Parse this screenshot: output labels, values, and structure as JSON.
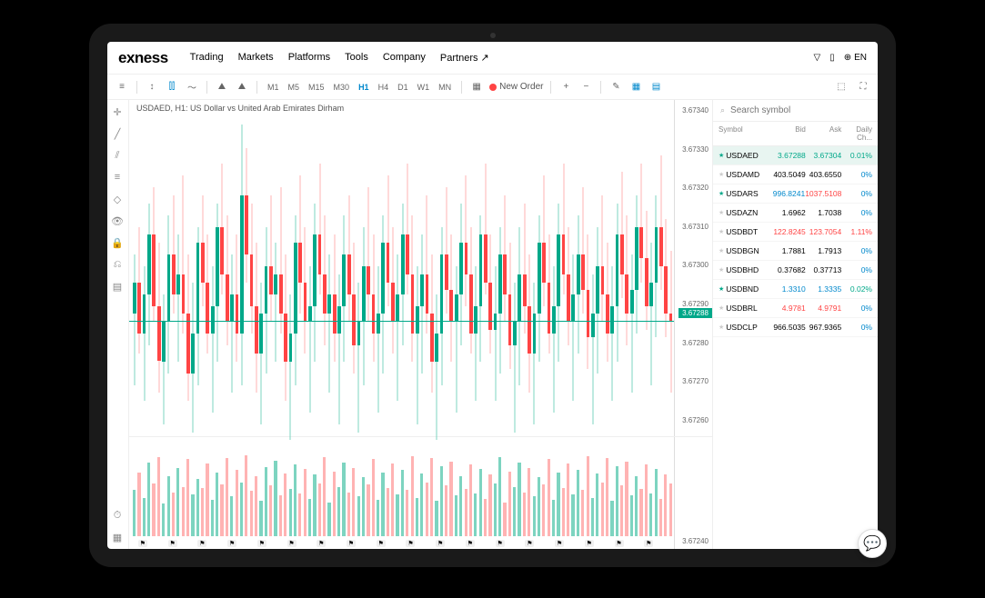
{
  "brand": "exness",
  "nav": [
    "Trading",
    "Markets",
    "Platforms",
    "Tools",
    "Company",
    "Partners ↗"
  ],
  "lang": "EN",
  "toolbar": {
    "timeframes": [
      "M1",
      "M5",
      "M15",
      "M30",
      "H1",
      "H4",
      "D1",
      "W1",
      "MN"
    ],
    "active_tf": "H1",
    "new_order": "New Order"
  },
  "chart": {
    "title": "USDAED, H1: US Dollar vs United Arab Emirates Dirham",
    "y_ticks": [
      "3.67340",
      "3.67330",
      "3.67320",
      "3.67310",
      "3.67300",
      "3.67290",
      "3.67280",
      "3.67270",
      "3.67260"
    ],
    "price_label": "3.67288",
    "sub_y": "3.67240"
  },
  "watchlist": {
    "search_ph": "Search symbol",
    "headers": [
      "Symbol",
      "Bid",
      "Ask",
      "Daily Ch..."
    ],
    "rows": [
      {
        "sym": "USDAED",
        "bid": "3.67288",
        "ask": "3.67304",
        "ch": "0.01%",
        "star": true,
        "bidc": "up",
        "askc": "up",
        "chc": "up",
        "active": true
      },
      {
        "sym": "USDAMD",
        "bid": "403.5049",
        "ask": "403.6550",
        "ch": "0%",
        "star": false,
        "bidc": "",
        "askc": "",
        "chc": "flat"
      },
      {
        "sym": "USDARS",
        "bid": "996.8241",
        "ask": "1037.5108",
        "ch": "0%",
        "star": true,
        "bidc": "blue",
        "askc": "down",
        "chc": "flat"
      },
      {
        "sym": "USDAZN",
        "bid": "1.6962",
        "ask": "1.7038",
        "ch": "0%",
        "star": false,
        "bidc": "",
        "askc": "",
        "chc": "flat"
      },
      {
        "sym": "USDBDT",
        "bid": "122.8245",
        "ask": "123.7054",
        "ch": "1.11%",
        "star": false,
        "bidc": "down",
        "askc": "down",
        "chc": "down"
      },
      {
        "sym": "USDBGN",
        "bid": "1.7881",
        "ask": "1.7913",
        "ch": "0%",
        "star": false,
        "bidc": "",
        "askc": "",
        "chc": "flat"
      },
      {
        "sym": "USDBHD",
        "bid": "0.37682",
        "ask": "0.37713",
        "ch": "0%",
        "star": false,
        "bidc": "",
        "askc": "",
        "chc": "flat"
      },
      {
        "sym": "USDBND",
        "bid": "1.3310",
        "ask": "1.3335",
        "ch": "0.02%",
        "star": true,
        "bidc": "blue",
        "askc": "blue",
        "chc": "up"
      },
      {
        "sym": "USDBRL",
        "bid": "4.9781",
        "ask": "4.9791",
        "ch": "0%",
        "star": false,
        "bidc": "down",
        "askc": "down",
        "chc": "flat"
      },
      {
        "sym": "USDCLP",
        "bid": "966.5035",
        "ask": "967.9365",
        "ch": "0%",
        "star": false,
        "bidc": "",
        "askc": "",
        "chc": "flat"
      }
    ]
  },
  "chart_data": {
    "type": "candlestick",
    "title": "USDAED H1",
    "ylim": [
      3.6726,
      3.6734
    ],
    "candles": [
      {
        "o": 3.6729,
        "h": 3.67305,
        "l": 3.67272,
        "c": 3.67298,
        "v": 42
      },
      {
        "o": 3.67298,
        "h": 3.67312,
        "l": 3.6728,
        "c": 3.67285,
        "v": 58
      },
      {
        "o": 3.67285,
        "h": 3.67302,
        "l": 3.67268,
        "c": 3.67295,
        "v": 35
      },
      {
        "o": 3.67295,
        "h": 3.67318,
        "l": 3.67282,
        "c": 3.6731,
        "v": 67
      },
      {
        "o": 3.6731,
        "h": 3.67322,
        "l": 3.67288,
        "c": 3.67292,
        "v": 48
      },
      {
        "o": 3.67292,
        "h": 3.67308,
        "l": 3.6727,
        "c": 3.67278,
        "v": 72
      },
      {
        "o": 3.67278,
        "h": 3.67295,
        "l": 3.67262,
        "c": 3.67288,
        "v": 30
      },
      {
        "o": 3.67288,
        "h": 3.67315,
        "l": 3.67275,
        "c": 3.67305,
        "v": 55
      },
      {
        "o": 3.67305,
        "h": 3.6732,
        "l": 3.6729,
        "c": 3.67295,
        "v": 40
      },
      {
        "o": 3.67295,
        "h": 3.6731,
        "l": 3.67278,
        "c": 3.673,
        "v": 62
      },
      {
        "o": 3.673,
        "h": 3.67325,
        "l": 3.67285,
        "c": 3.6729,
        "v": 45
      },
      {
        "o": 3.6729,
        "h": 3.67305,
        "l": 3.67268,
        "c": 3.67275,
        "v": 70
      },
      {
        "o": 3.67275,
        "h": 3.67298,
        "l": 3.6726,
        "c": 3.67285,
        "v": 38
      },
      {
        "o": 3.67285,
        "h": 3.67312,
        "l": 3.67272,
        "c": 3.67308,
        "v": 52
      },
      {
        "o": 3.67308,
        "h": 3.6732,
        "l": 3.67292,
        "c": 3.67298,
        "v": 44
      },
      {
        "o": 3.67298,
        "h": 3.6731,
        "l": 3.6728,
        "c": 3.67285,
        "v": 66
      },
      {
        "o": 3.67285,
        "h": 3.67302,
        "l": 3.67265,
        "c": 3.67292,
        "v": 33
      },
      {
        "o": 3.67292,
        "h": 3.67318,
        "l": 3.67278,
        "c": 3.67312,
        "v": 58
      },
      {
        "o": 3.67312,
        "h": 3.67328,
        "l": 3.67295,
        "c": 3.673,
        "v": 47
      },
      {
        "o": 3.673,
        "h": 3.67315,
        "l": 3.67282,
        "c": 3.67288,
        "v": 71
      },
      {
        "o": 3.67288,
        "h": 3.67305,
        "l": 3.6727,
        "c": 3.67295,
        "v": 36
      },
      {
        "o": 3.67295,
        "h": 3.6731,
        "l": 3.67278,
        "c": 3.67285,
        "v": 60
      },
      {
        "o": 3.67285,
        "h": 3.67338,
        "l": 3.67272,
        "c": 3.6732,
        "v": 49
      },
      {
        "o": 3.6732,
        "h": 3.67332,
        "l": 3.67298,
        "c": 3.67305,
        "v": 74
      },
      {
        "o": 3.67305,
        "h": 3.67318,
        "l": 3.67285,
        "c": 3.67292,
        "v": 41
      },
      {
        "o": 3.67292,
        "h": 3.67308,
        "l": 3.6727,
        "c": 3.6728,
        "v": 55
      },
      {
        "o": 3.6728,
        "h": 3.67298,
        "l": 3.67262,
        "c": 3.6729,
        "v": 32
      },
      {
        "o": 3.6729,
        "h": 3.67312,
        "l": 3.67275,
        "c": 3.67302,
        "v": 63
      },
      {
        "o": 3.67302,
        "h": 3.6732,
        "l": 3.67288,
        "c": 3.67295,
        "v": 46
      },
      {
        "o": 3.67295,
        "h": 3.67308,
        "l": 3.67278,
        "c": 3.673,
        "v": 69
      },
      {
        "o": 3.673,
        "h": 3.67322,
        "l": 3.67285,
        "c": 3.6729,
        "v": 37
      },
      {
        "o": 3.6729,
        "h": 3.67305,
        "l": 3.67268,
        "c": 3.67278,
        "v": 57
      },
      {
        "o": 3.67278,
        "h": 3.67295,
        "l": 3.67258,
        "c": 3.67285,
        "v": 43
      },
      {
        "o": 3.67285,
        "h": 3.67315,
        "l": 3.67272,
        "c": 3.67308,
        "v": 65
      },
      {
        "o": 3.67308,
        "h": 3.67325,
        "l": 3.6729,
        "c": 3.67298,
        "v": 39
      },
      {
        "o": 3.67298,
        "h": 3.67312,
        "l": 3.6728,
        "c": 3.67288,
        "v": 61
      },
      {
        "o": 3.67288,
        "h": 3.67302,
        "l": 3.67265,
        "c": 3.67292,
        "v": 34
      },
      {
        "o": 3.67292,
        "h": 3.67318,
        "l": 3.67278,
        "c": 3.6731,
        "v": 56
      },
      {
        "o": 3.6731,
        "h": 3.67328,
        "l": 3.67295,
        "c": 3.673,
        "v": 48
      },
      {
        "o": 3.673,
        "h": 3.67315,
        "l": 3.67282,
        "c": 3.6729,
        "v": 72
      },
      {
        "o": 3.6729,
        "h": 3.67305,
        "l": 3.6727,
        "c": 3.67295,
        "v": 31
      },
      {
        "o": 3.67295,
        "h": 3.6731,
        "l": 3.67278,
        "c": 3.67285,
        "v": 59
      },
      {
        "o": 3.67285,
        "h": 3.673,
        "l": 3.67262,
        "c": 3.67292,
        "v": 45
      },
      {
        "o": 3.67292,
        "h": 3.67315,
        "l": 3.67278,
        "c": 3.67305,
        "v": 67
      },
      {
        "o": 3.67305,
        "h": 3.6732,
        "l": 3.67288,
        "c": 3.67295,
        "v": 40
      },
      {
        "o": 3.67295,
        "h": 3.67308,
        "l": 3.67275,
        "c": 3.67282,
        "v": 62
      },
      {
        "o": 3.67282,
        "h": 3.67298,
        "l": 3.6726,
        "c": 3.67288,
        "v": 36
      },
      {
        "o": 3.67288,
        "h": 3.67312,
        "l": 3.67272,
        "c": 3.67302,
        "v": 54
      },
      {
        "o": 3.67302,
        "h": 3.67322,
        "l": 3.67288,
        "c": 3.67295,
        "v": 47
      },
      {
        "o": 3.67295,
        "h": 3.6731,
        "l": 3.67278,
        "c": 3.67285,
        "v": 70
      },
      {
        "o": 3.67285,
        "h": 3.67302,
        "l": 3.67265,
        "c": 3.6729,
        "v": 33
      },
      {
        "o": 3.6729,
        "h": 3.67315,
        "l": 3.67275,
        "c": 3.67308,
        "v": 58
      },
      {
        "o": 3.67308,
        "h": 3.67325,
        "l": 3.67292,
        "c": 3.67298,
        "v": 44
      },
      {
        "o": 3.67298,
        "h": 3.67312,
        "l": 3.6728,
        "c": 3.67288,
        "v": 66
      },
      {
        "o": 3.67288,
        "h": 3.67305,
        "l": 3.67268,
        "c": 3.67295,
        "v": 38
      },
      {
        "o": 3.67295,
        "h": 3.67318,
        "l": 3.67282,
        "c": 3.6731,
        "v": 60
      },
      {
        "o": 3.6731,
        "h": 3.67328,
        "l": 3.67295,
        "c": 3.673,
        "v": 42
      },
      {
        "o": 3.673,
        "h": 3.67315,
        "l": 3.67278,
        "c": 3.67285,
        "v": 73
      },
      {
        "o": 3.67285,
        "h": 3.67302,
        "l": 3.67262,
        "c": 3.67292,
        "v": 35
      },
      {
        "o": 3.67292,
        "h": 3.6731,
        "l": 3.67275,
        "c": 3.673,
        "v": 57
      },
      {
        "o": 3.673,
        "h": 3.6732,
        "l": 3.67285,
        "c": 3.6729,
        "v": 49
      },
      {
        "o": 3.6729,
        "h": 3.67305,
        "l": 3.6727,
        "c": 3.67278,
        "v": 71
      },
      {
        "o": 3.67278,
        "h": 3.67295,
        "l": 3.67258,
        "c": 3.67285,
        "v": 32
      },
      {
        "o": 3.67285,
        "h": 3.67312,
        "l": 3.67272,
        "c": 3.67305,
        "v": 64
      },
      {
        "o": 3.67305,
        "h": 3.67322,
        "l": 3.6729,
        "c": 3.67296,
        "v": 46
      },
      {
        "o": 3.67296,
        "h": 3.6731,
        "l": 3.67278,
        "c": 3.67288,
        "v": 68
      },
      {
        "o": 3.67288,
        "h": 3.67302,
        "l": 3.67265,
        "c": 3.67295,
        "v": 37
      },
      {
        "o": 3.67295,
        "h": 3.67318,
        "l": 3.67282,
        "c": 3.67308,
        "v": 55
      },
      {
        "o": 3.67308,
        "h": 3.67325,
        "l": 3.67292,
        "c": 3.673,
        "v": 43
      },
      {
        "o": 3.673,
        "h": 3.67312,
        "l": 3.6728,
        "c": 3.67285,
        "v": 65
      },
      {
        "o": 3.67285,
        "h": 3.67302,
        "l": 3.67268,
        "c": 3.67292,
        "v": 39
      },
      {
        "o": 3.67292,
        "h": 3.67315,
        "l": 3.67278,
        "c": 3.6731,
        "v": 61
      },
      {
        "o": 3.6731,
        "h": 3.67328,
        "l": 3.67295,
        "c": 3.67298,
        "v": 34
      },
      {
        "o": 3.67298,
        "h": 3.6731,
        "l": 3.6728,
        "c": 3.67286,
        "v": 56
      },
      {
        "o": 3.67286,
        "h": 3.67302,
        "l": 3.67268,
        "c": 3.6729,
        "v": 48
      },
      {
        "o": 3.6729,
        "h": 3.67312,
        "l": 3.67275,
        "c": 3.67305,
        "v": 72
      },
      {
        "o": 3.67305,
        "h": 3.6732,
        "l": 3.67288,
        "c": 3.67295,
        "v": 31
      },
      {
        "o": 3.67295,
        "h": 3.67308,
        "l": 3.67276,
        "c": 3.67282,
        "v": 59
      },
      {
        "o": 3.67282,
        "h": 3.67298,
        "l": 3.6726,
        "c": 3.67288,
        "v": 45
      },
      {
        "o": 3.67288,
        "h": 3.67312,
        "l": 3.67272,
        "c": 3.673,
        "v": 67
      },
      {
        "o": 3.673,
        "h": 3.67318,
        "l": 3.67285,
        "c": 3.67292,
        "v": 40
      },
      {
        "o": 3.67292,
        "h": 3.67305,
        "l": 3.6727,
        "c": 3.6728,
        "v": 62
      },
      {
        "o": 3.6728,
        "h": 3.67298,
        "l": 3.67262,
        "c": 3.6729,
        "v": 36
      },
      {
        "o": 3.6729,
        "h": 3.67315,
        "l": 3.67278,
        "c": 3.67308,
        "v": 54
      },
      {
        "o": 3.67308,
        "h": 3.67325,
        "l": 3.67292,
        "c": 3.67298,
        "v": 47
      },
      {
        "o": 3.67298,
        "h": 3.6731,
        "l": 3.6728,
        "c": 3.67285,
        "v": 70
      },
      {
        "o": 3.67285,
        "h": 3.67302,
        "l": 3.67265,
        "c": 3.67292,
        "v": 33
      },
      {
        "o": 3.67292,
        "h": 3.67318,
        "l": 3.67278,
        "c": 3.6731,
        "v": 58
      },
      {
        "o": 3.6731,
        "h": 3.67328,
        "l": 3.67295,
        "c": 3.673,
        "v": 44
      },
      {
        "o": 3.673,
        "h": 3.67312,
        "l": 3.67282,
        "c": 3.67288,
        "v": 66
      },
      {
        "o": 3.67288,
        "h": 3.67305,
        "l": 3.67268,
        "c": 3.67295,
        "v": 38
      },
      {
        "o": 3.67295,
        "h": 3.67315,
        "l": 3.6728,
        "c": 3.67305,
        "v": 60
      },
      {
        "o": 3.67305,
        "h": 3.67322,
        "l": 3.6729,
        "c": 3.67296,
        "v": 42
      },
      {
        "o": 3.67296,
        "h": 3.6731,
        "l": 3.67276,
        "c": 3.67284,
        "v": 73
      },
      {
        "o": 3.67284,
        "h": 3.673,
        "l": 3.67262,
        "c": 3.6729,
        "v": 35
      },
      {
        "o": 3.6729,
        "h": 3.67312,
        "l": 3.67275,
        "c": 3.67302,
        "v": 57
      },
      {
        "o": 3.67302,
        "h": 3.6732,
        "l": 3.67288,
        "c": 3.67295,
        "v": 49
      },
      {
        "o": 3.67295,
        "h": 3.67308,
        "l": 3.67278,
        "c": 3.67285,
        "v": 71
      },
      {
        "o": 3.67285,
        "h": 3.67302,
        "l": 3.67268,
        "c": 3.67292,
        "v": 32
      },
      {
        "o": 3.67292,
        "h": 3.67318,
        "l": 3.67278,
        "c": 3.6731,
        "v": 64
      },
      {
        "o": 3.6731,
        "h": 3.67326,
        "l": 3.67294,
        "c": 3.673,
        "v": 46
      },
      {
        "o": 3.673,
        "h": 3.67315,
        "l": 3.67282,
        "c": 3.6729,
        "v": 68
      },
      {
        "o": 3.6729,
        "h": 3.67305,
        "l": 3.6727,
        "c": 3.67296,
        "v": 37
      },
      {
        "o": 3.67296,
        "h": 3.6732,
        "l": 3.67285,
        "c": 3.67312,
        "v": 55
      },
      {
        "o": 3.67312,
        "h": 3.67328,
        "l": 3.67298,
        "c": 3.67304,
        "v": 43
      },
      {
        "o": 3.67304,
        "h": 3.67316,
        "l": 3.67286,
        "c": 3.67292,
        "v": 65
      },
      {
        "o": 3.67292,
        "h": 3.67308,
        "l": 3.67272,
        "c": 3.67298,
        "v": 39
      },
      {
        "o": 3.67298,
        "h": 3.6732,
        "l": 3.67284,
        "c": 3.67312,
        "v": 61
      },
      {
        "o": 3.67312,
        "h": 3.6733,
        "l": 3.67296,
        "c": 3.67302,
        "v": 34
      },
      {
        "o": 3.67302,
        "h": 3.67314,
        "l": 3.67284,
        "c": 3.6729,
        "v": 56
      },
      {
        "o": 3.6729,
        "h": 3.67306,
        "l": 3.6727,
        "c": 3.67288,
        "v": 48
      }
    ]
  }
}
